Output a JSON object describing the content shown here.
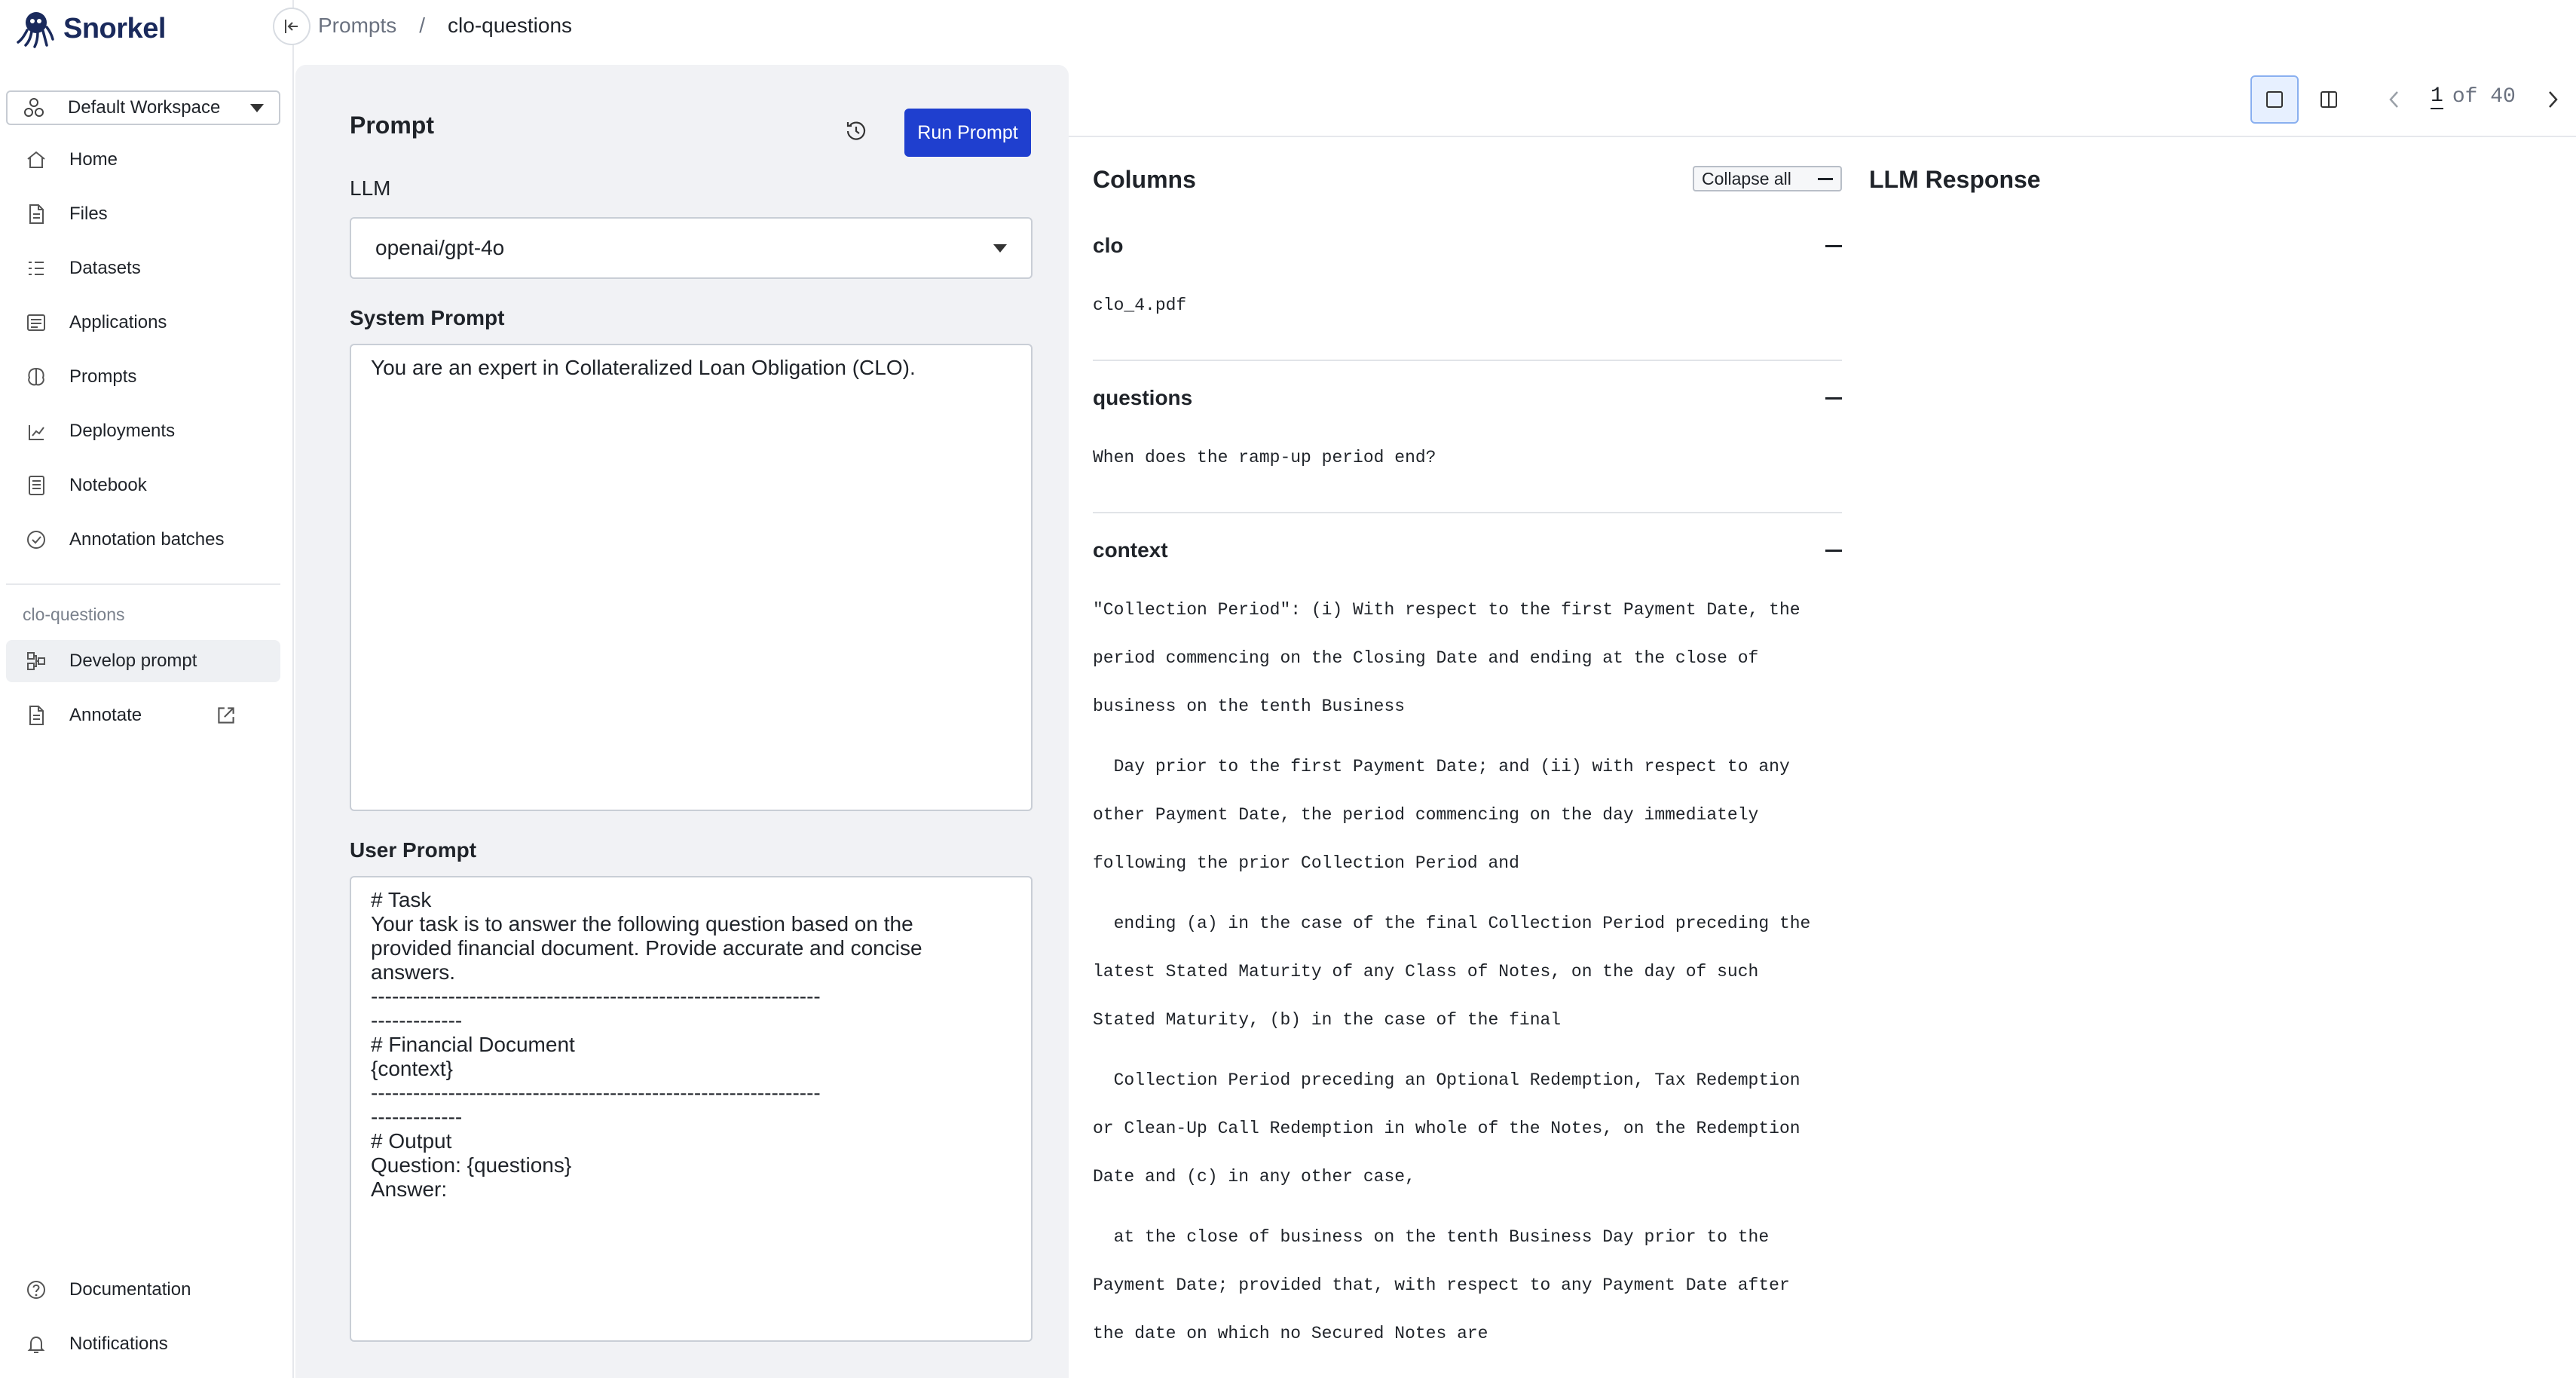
{
  "app": {
    "name": "Snorkel"
  },
  "workspace": {
    "label": "Default Workspace"
  },
  "nav": [
    {
      "label": "Home",
      "icon": "home-icon"
    },
    {
      "label": "Files",
      "icon": "file-icon"
    },
    {
      "label": "Datasets",
      "icon": "datasets-icon"
    },
    {
      "label": "Applications",
      "icon": "applications-icon"
    },
    {
      "label": "Prompts",
      "icon": "prompts-icon"
    },
    {
      "label": "Deployments",
      "icon": "deployments-icon"
    },
    {
      "label": "Notebook",
      "icon": "notebook-icon"
    },
    {
      "label": "Annotation batches",
      "icon": "check-circle-icon"
    }
  ],
  "project": {
    "label": "clo-questions",
    "items": [
      {
        "label": "Develop prompt",
        "icon": "develop-icon",
        "active": true
      },
      {
        "label": "Annotate",
        "icon": "file-icon",
        "external": true
      }
    ]
  },
  "footer": [
    {
      "label": "Documentation",
      "icon": "help-icon"
    },
    {
      "label": "Notifications",
      "icon": "bell-icon"
    }
  ],
  "breadcrumb": {
    "parent": "Prompts",
    "separator": "/",
    "current": "clo-questions"
  },
  "prompt_panel": {
    "title": "Prompt",
    "run_label": "Run Prompt",
    "llm_label": "LLM",
    "llm_value": "openai/gpt-4o",
    "system_label": "System Prompt",
    "system_text": "You are an expert in Collateralized Loan Obligation (CLO).",
    "user_label": "User Prompt",
    "user_text": "# Task\nYour task is to answer the following question based on the\nprovided financial document. Provide accurate and concise\nanswers.\n----------------------------------------------------------------\n-------------\n# Financial Document\n{context}\n----------------------------------------------------------------\n-------------\n# Output\nQuestion: {questions}\nAnswer:"
  },
  "pager": {
    "current": "1",
    "of_text": "of 40"
  },
  "columns": {
    "title": "Columns",
    "collapse_all": "Collapse all",
    "fields": [
      {
        "name": "clo",
        "value": "clo_4.pdf"
      },
      {
        "name": "questions",
        "value": "When does the ramp-up period end?"
      },
      {
        "name": "context"
      }
    ],
    "context_lines": [
      "\"Collection Period\": (i) With respect to the first Payment Date, the",
      "period commencing on the Closing Date and ending at the close of",
      "business on the tenth Business",
      "  Day prior to the first Payment Date; and (ii) with respect to any",
      "other Payment Date, the period commencing on the day immediately",
      "following the prior Collection Period and",
      "  ending (a) in the case of the final Collection Period preceding the",
      "latest Stated Maturity of any Class of Notes, on the day of such",
      "Stated Maturity, (b) in the case of the final",
      "  Collection Period preceding an Optional Redemption, Tax Redemption",
      "or Clean-Up Call Redemption in whole of the Notes, on the Redemption",
      "Date and (c) in any other case,",
      "  at the close of business on the tenth Business Day prior to the",
      "Payment Date; provided that, with respect to any Payment Date after",
      "the date on which no Secured Notes are"
    ]
  },
  "llm_response": {
    "title": "LLM Response"
  },
  "colors": {
    "accent": "#1f3fcf",
    "panel_bg": "#f1f2f5",
    "active_view": "#e7f0ff"
  }
}
